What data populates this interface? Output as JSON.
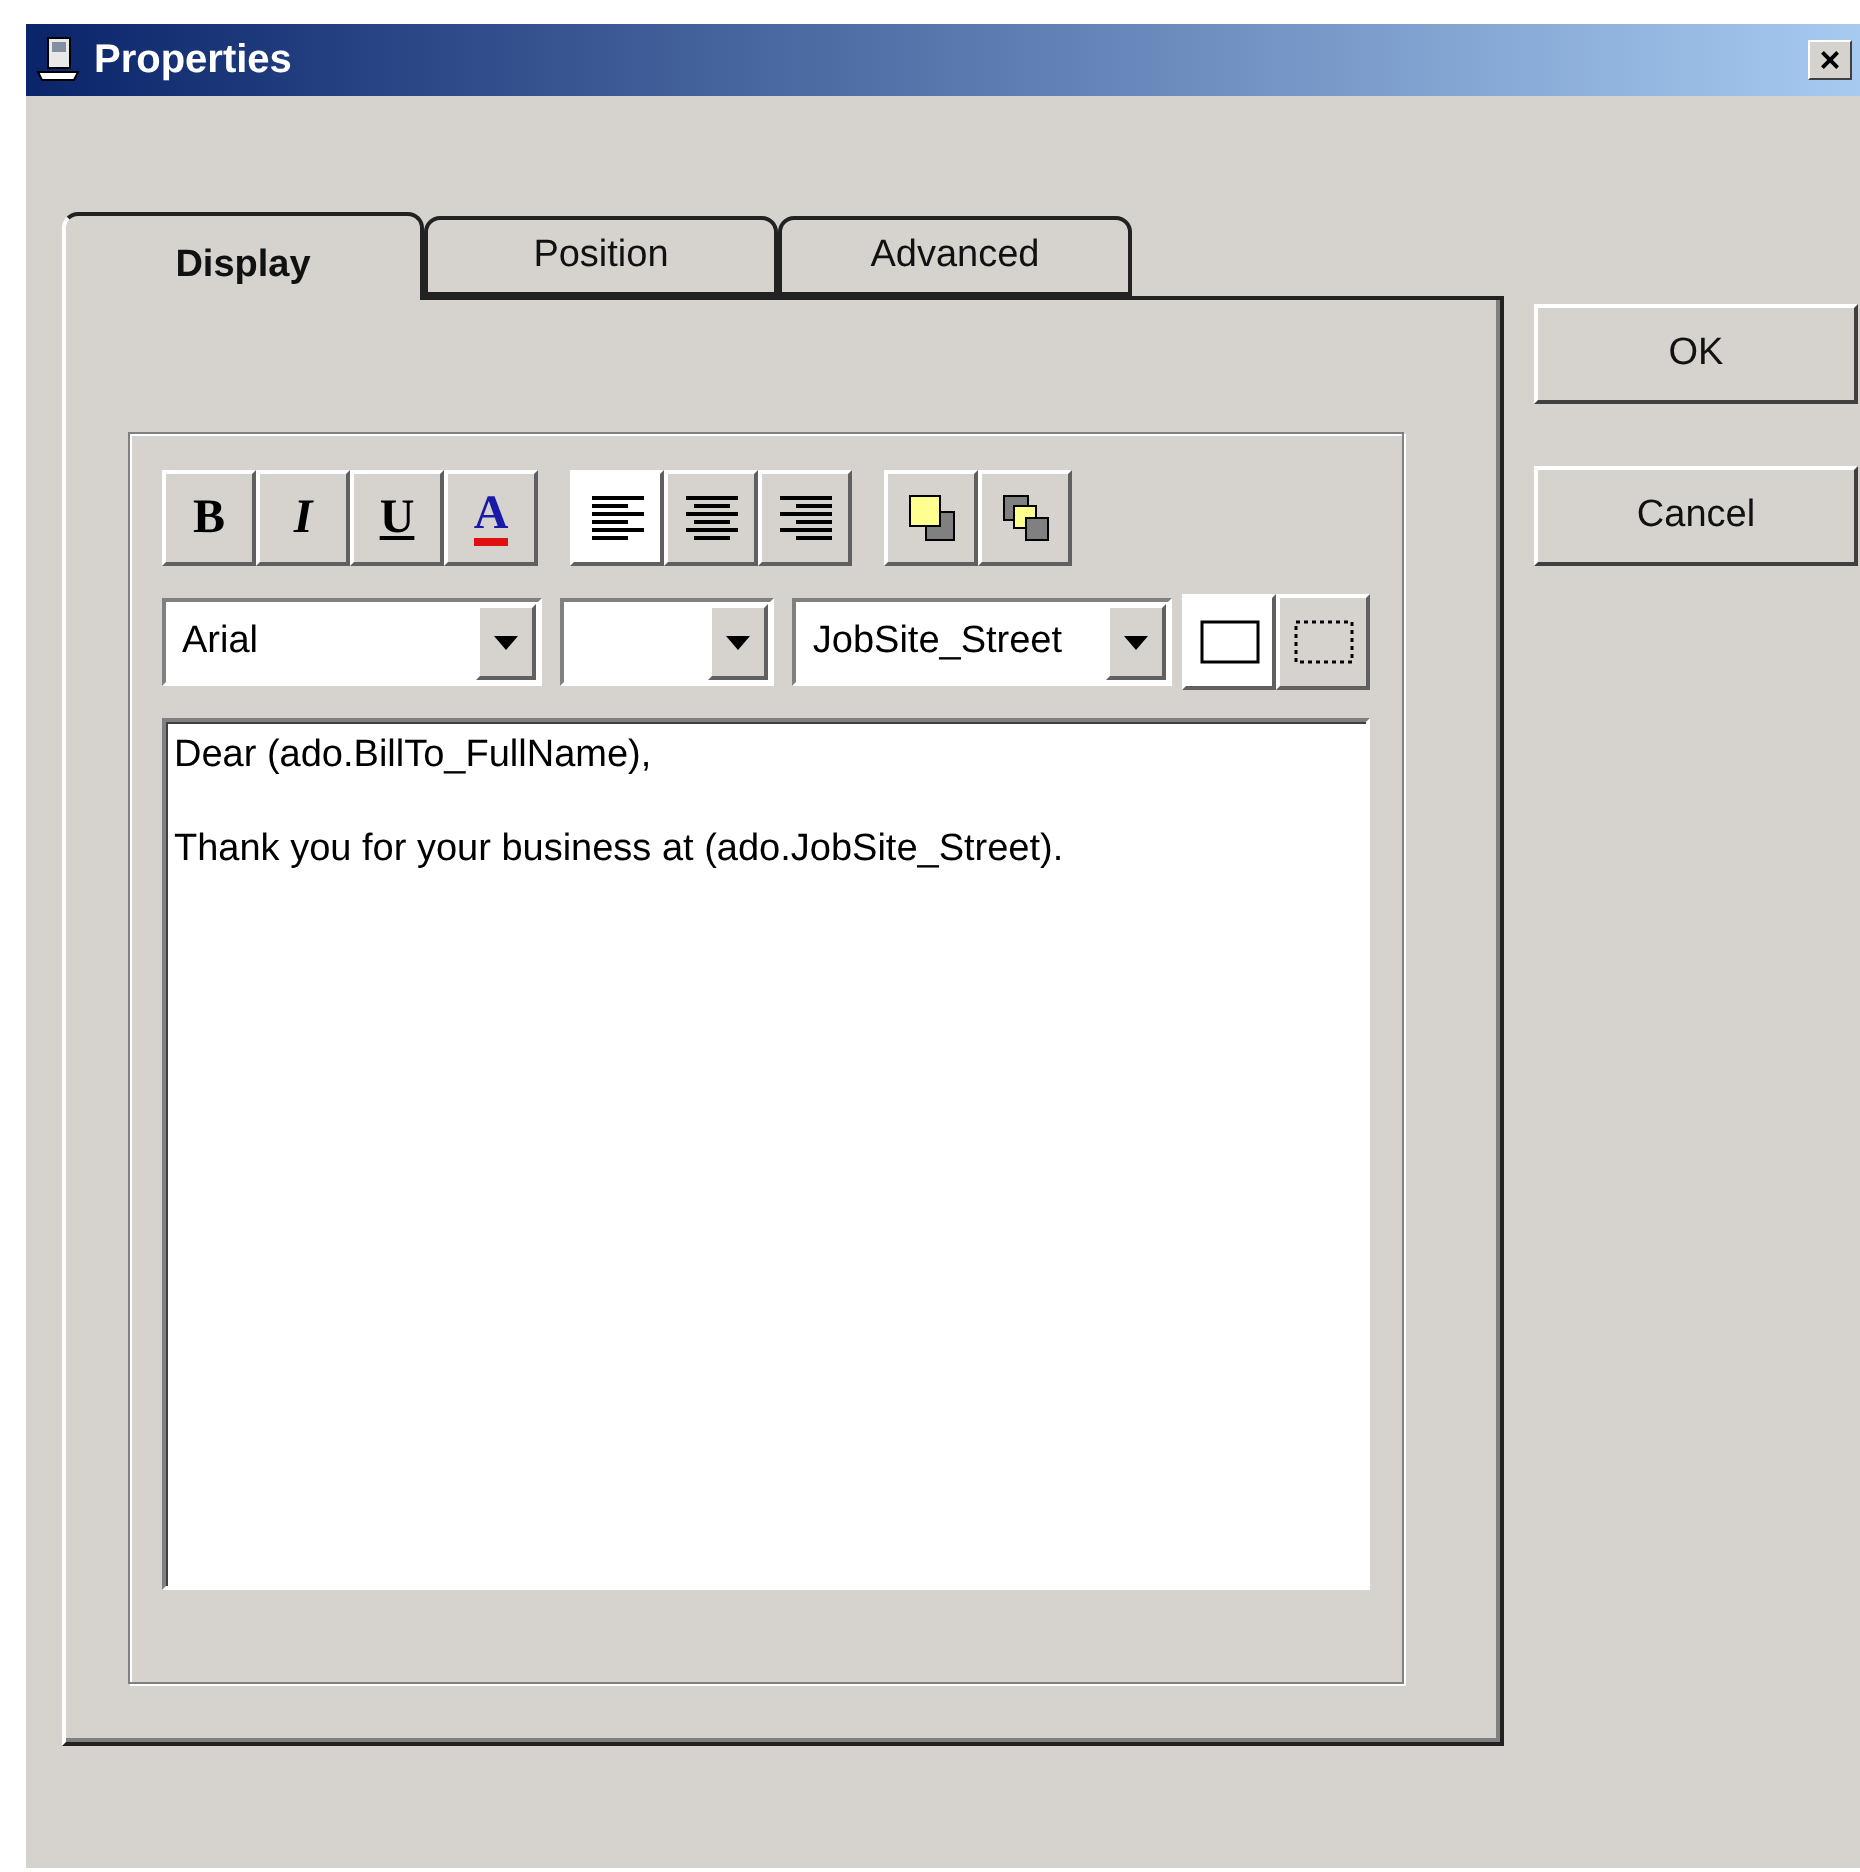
{
  "window": {
    "title": "Properties",
    "close": "×"
  },
  "tabs": [
    {
      "label": "Display",
      "selected": true
    },
    {
      "label": "Position",
      "selected": false
    },
    {
      "label": "Advanced",
      "selected": false
    }
  ],
  "format_buttons": [
    {
      "label": "B",
      "kind": "bold"
    },
    {
      "label": "I",
      "kind": "italic"
    },
    {
      "label": "U",
      "kind": "underline"
    },
    {
      "label": "A",
      "kind": "color"
    }
  ],
  "align_buttons": [
    {
      "kind": "left",
      "selected": true
    },
    {
      "kind": "center",
      "selected": false
    },
    {
      "kind": "right",
      "selected": false
    }
  ],
  "order_buttons": [
    {
      "kind": "front"
    },
    {
      "kind": "back"
    }
  ],
  "dropdowns": [
    {
      "kind": "font",
      "value": "Arial"
    },
    {
      "kind": "size"
    },
    {
      "kind": "field",
      "value": "JobSite_Street"
    }
  ],
  "border_buttons": [
    {
      "kind": "solid",
      "selected": true
    },
    {
      "kind": "dotted",
      "selected": false
    }
  ],
  "body_paragraphs": [
    "Dear (ado.BillTo_FullName),",
    "Thank you for your business at (ado.JobSite_Street)."
  ],
  "buttons": [
    "OK",
    "Cancel"
  ]
}
